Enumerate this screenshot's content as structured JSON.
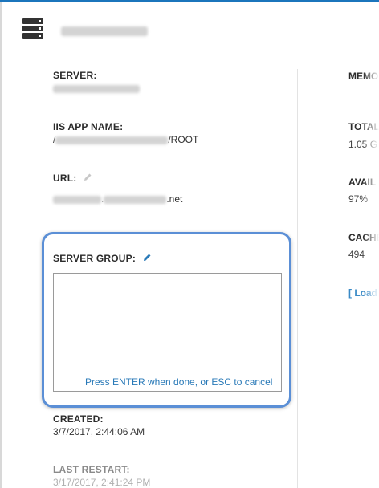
{
  "left": {
    "server_label": "SERVER:",
    "iis_label": "IIS APP NAME:",
    "iis_prefix": "/",
    "iis_suffix": "/ROOT",
    "url_label": "URL:",
    "url_suffix": ".net",
    "server_group_label": "SERVER GROUP:",
    "edit_hint": "Press ENTER when done, or ESC to cancel",
    "created_label": "CREATED:",
    "created_value": "3/7/2017, 2:44:06 AM",
    "last_restart_label": "LAST RESTART:",
    "last_restart_value": "3/17/2017, 2:41:24 PM"
  },
  "right": {
    "memory_label": "MEMO",
    "total_label": "TOTAL",
    "total_value": "1.05 G",
    "available_label": "AVAIL",
    "available_value": "97%",
    "cache_label": "CACHE",
    "cache_value": "494",
    "load_link": "[ Load"
  },
  "icons": {
    "header": "server-stack-icon",
    "url_edit": "pencil-icon",
    "group_edit": "pencil-icon"
  },
  "colors": {
    "accent": "#1b75bc",
    "focus_border": "#5b8fd6",
    "hint": "#2a7ab8",
    "link": "#3a8ac6"
  }
}
